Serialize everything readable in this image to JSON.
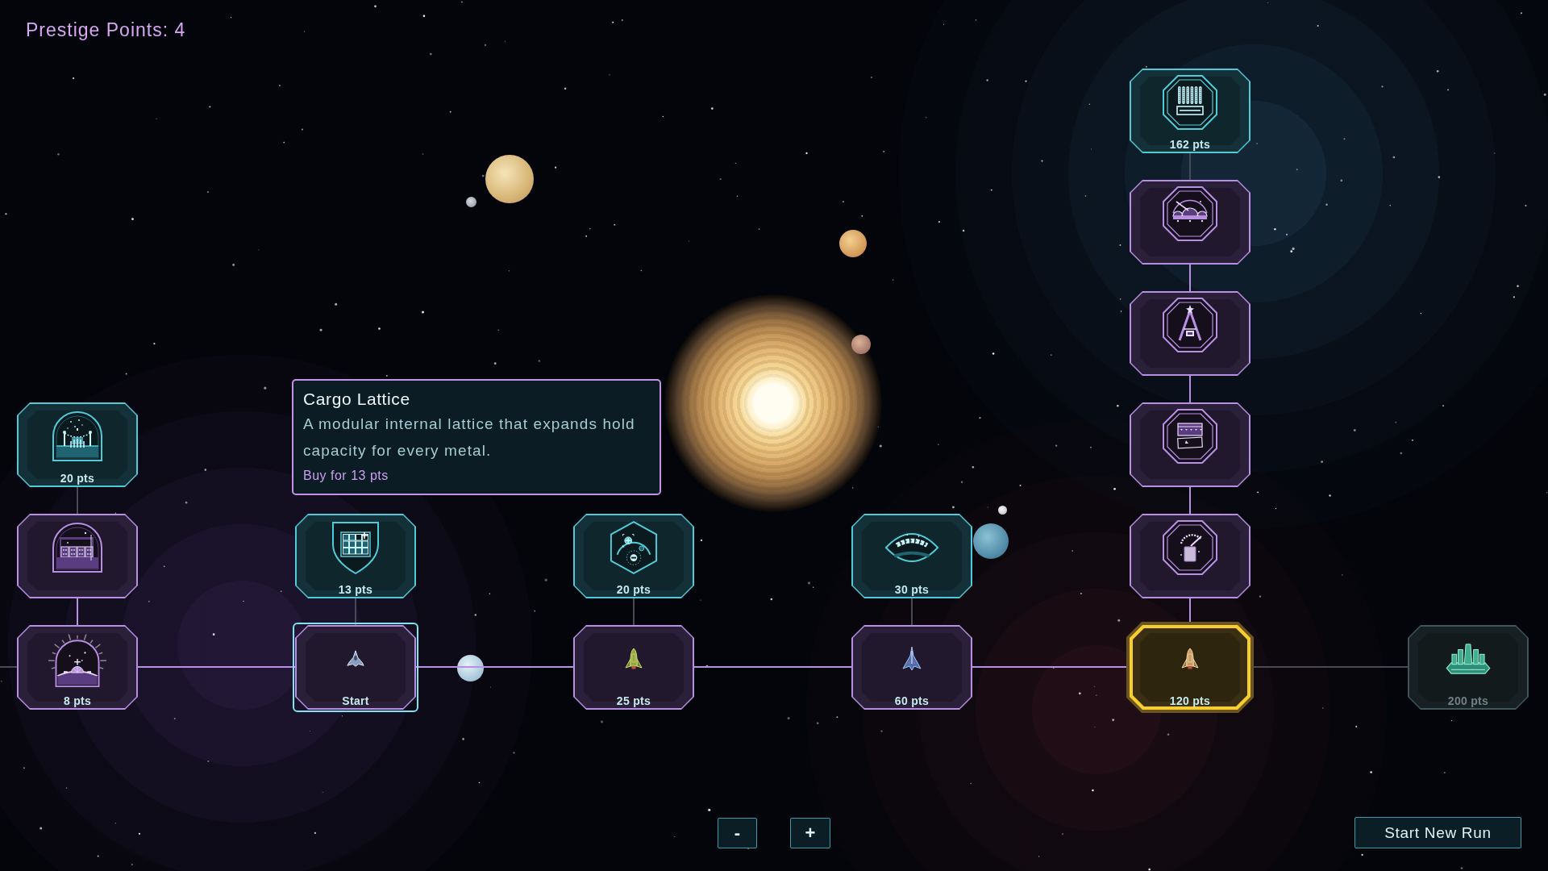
{
  "prestige": "Prestige Points: 4",
  "tree": [
    {
      "label": "8 pts",
      "owned": true,
      "locked": false,
      "selected": false,
      "current": false,
      "branch": [
        {
          "owned": true,
          "locked": false,
          "selected": false,
          "current": false
        },
        {
          "label": "20 pts",
          "owned": false,
          "locked": false,
          "selected": false,
          "current": false
        }
      ]
    },
    {
      "label": "Start",
      "owned": true,
      "locked": false,
      "selected": false,
      "current": true,
      "branch": [
        {
          "label": "13 pts",
          "owned": false,
          "locked": false,
          "selected": false,
          "current": false
        }
      ]
    },
    {
      "label": "25 pts",
      "owned": true,
      "locked": false,
      "selected": false,
      "current": false,
      "branch": [
        {
          "label": "20 pts",
          "owned": false,
          "locked": false,
          "selected": false,
          "current": false
        }
      ]
    },
    {
      "label": "60 pts",
      "owned": true,
      "locked": false,
      "selected": false,
      "current": false,
      "branch": [
        {
          "label": "30 pts",
          "owned": false,
          "locked": false,
          "selected": false,
          "current": false
        }
      ]
    },
    {
      "label": "120 pts",
      "owned": true,
      "locked": false,
      "selected": true,
      "current": false,
      "branch": [
        {
          "owned": true,
          "locked": false,
          "selected": false,
          "current": false
        },
        {
          "owned": true,
          "locked": false,
          "selected": false,
          "current": false
        },
        {
          "owned": true,
          "locked": false,
          "selected": false,
          "current": false
        },
        {
          "owned": true,
          "locked": false,
          "selected": false,
          "current": false
        },
        {
          "label": "162 pts",
          "owned": false,
          "locked": false,
          "selected": false,
          "current": false
        }
      ]
    },
    {
      "label": "200 pts",
      "owned": false,
      "locked": true,
      "selected": false,
      "current": false
    }
  ],
  "tooltip": {
    "title": "Cargo Lattice",
    "description": "A modular internal lattice that expands hold capacity for every metal.",
    "price": "Buy for 13 pts"
  },
  "zoom_buttons": [
    "-",
    "+"
  ],
  "start_button": "Start New Run"
}
